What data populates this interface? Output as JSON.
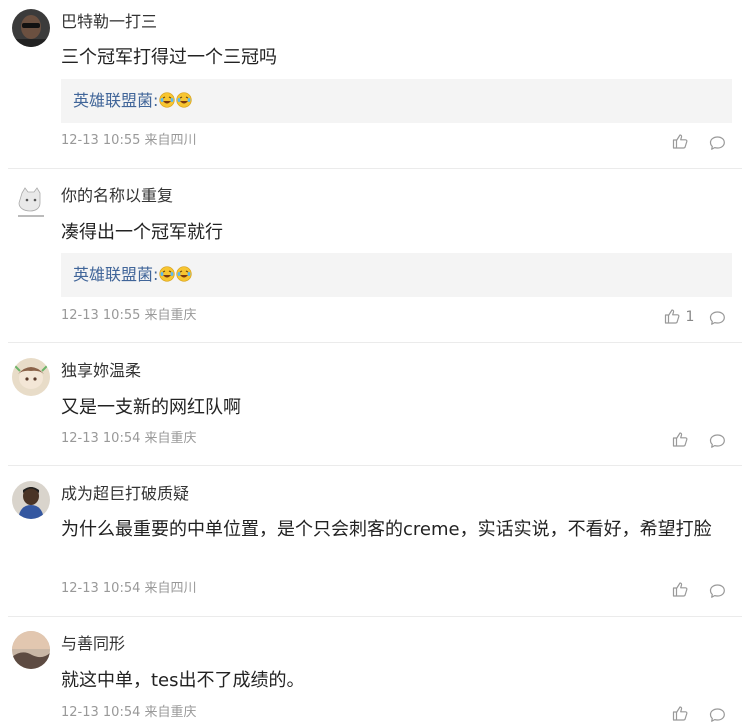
{
  "comments": [
    {
      "username": "巴特勒一打三",
      "text": "三个冠军打得过一个三冠吗",
      "reply": {
        "user": "英雄联盟菌:",
        "emoji": [
          "laughing-tears-emoji",
          "laughing-tears-emoji"
        ]
      },
      "date": "12-13 10:55",
      "location": "来自四川",
      "likes": ""
    },
    {
      "username": "你的名称以重复",
      "text": "凑得出一个冠军就行",
      "reply": {
        "user": "英雄联盟菌:",
        "emoji": [
          "laughing-tears-emoji",
          "laughing-tears-emoji"
        ]
      },
      "date": "12-13 10:55",
      "location": "来自重庆",
      "likes": "1"
    },
    {
      "username": "独享妳温柔",
      "text": "又是一支新的网红队啊",
      "date": "12-13 10:54",
      "location": "来自重庆",
      "likes": ""
    },
    {
      "username": "成为超巨打破质疑",
      "text": "为什么最重要的中单位置，是个只会刺客的creme，实话实说，不看好，希望打脸",
      "date": "12-13 10:54",
      "location": "来自四川",
      "likes": ""
    },
    {
      "username": "与善同形",
      "text": "就这中单，tes出不了成绩的。",
      "date": "12-13 10:54",
      "location": "来自重庆",
      "likes": ""
    }
  ],
  "colors": {
    "reply_name": "#406599",
    "meta_text": "#999999",
    "reply_bg": "#f4f4f4"
  }
}
